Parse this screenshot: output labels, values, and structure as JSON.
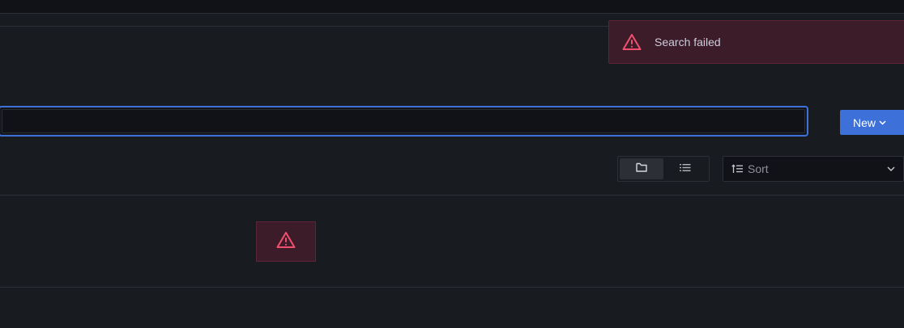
{
  "toast": {
    "message": "Search failed",
    "icon": "warning-icon",
    "color": "#f0506e"
  },
  "search": {
    "value": "",
    "placeholder": ""
  },
  "toolbar": {
    "new_label": "New",
    "sort_label": "Sort",
    "views": [
      {
        "icon": "folder-icon",
        "active": true
      },
      {
        "icon": "list-icon",
        "active": false
      }
    ]
  },
  "results": {
    "error_icon": "warning-icon"
  },
  "colors": {
    "primary": "#3d71d9",
    "error": "#f0506e",
    "background": "#181b1f"
  }
}
